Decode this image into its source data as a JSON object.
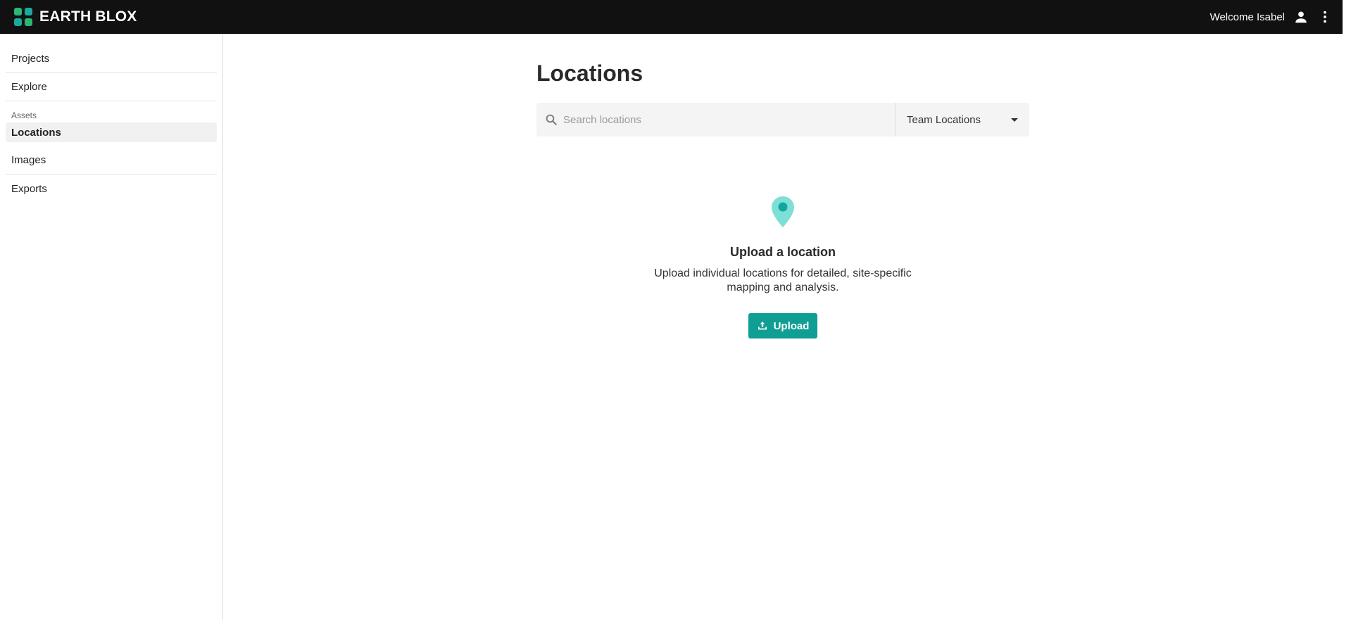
{
  "app": {
    "brand_name": "EARTH BLOX",
    "welcome_text": "Welcome Isabel"
  },
  "sidebar": {
    "items": [
      {
        "label": "Projects"
      },
      {
        "label": "Explore"
      }
    ],
    "section_label": "Assets",
    "asset_items": [
      {
        "label": "Locations",
        "active": true
      },
      {
        "label": "Images"
      },
      {
        "label": "Exports"
      }
    ]
  },
  "main": {
    "title": "Locations",
    "search": {
      "placeholder": "Search locations",
      "value": ""
    },
    "filter": {
      "selected": "Team Locations"
    },
    "empty_state": {
      "title": "Upload a location",
      "description": "Upload individual locations for detailed, site-specific mapping and analysis.",
      "button_label": "Upload"
    }
  },
  "colors": {
    "topbar": "#111111",
    "accent": "#0e9e93",
    "pin": "#7edfd6",
    "pin_dot": "#0fa99c",
    "logo_green": "#2bb673",
    "logo_teal": "#1aa99d"
  },
  "icons": {
    "user": "user-icon",
    "more": "more-vertical-icon",
    "search": "search-icon",
    "dropdown": "caret-down-icon",
    "pin": "location-pin-icon",
    "upload": "upload-icon"
  }
}
